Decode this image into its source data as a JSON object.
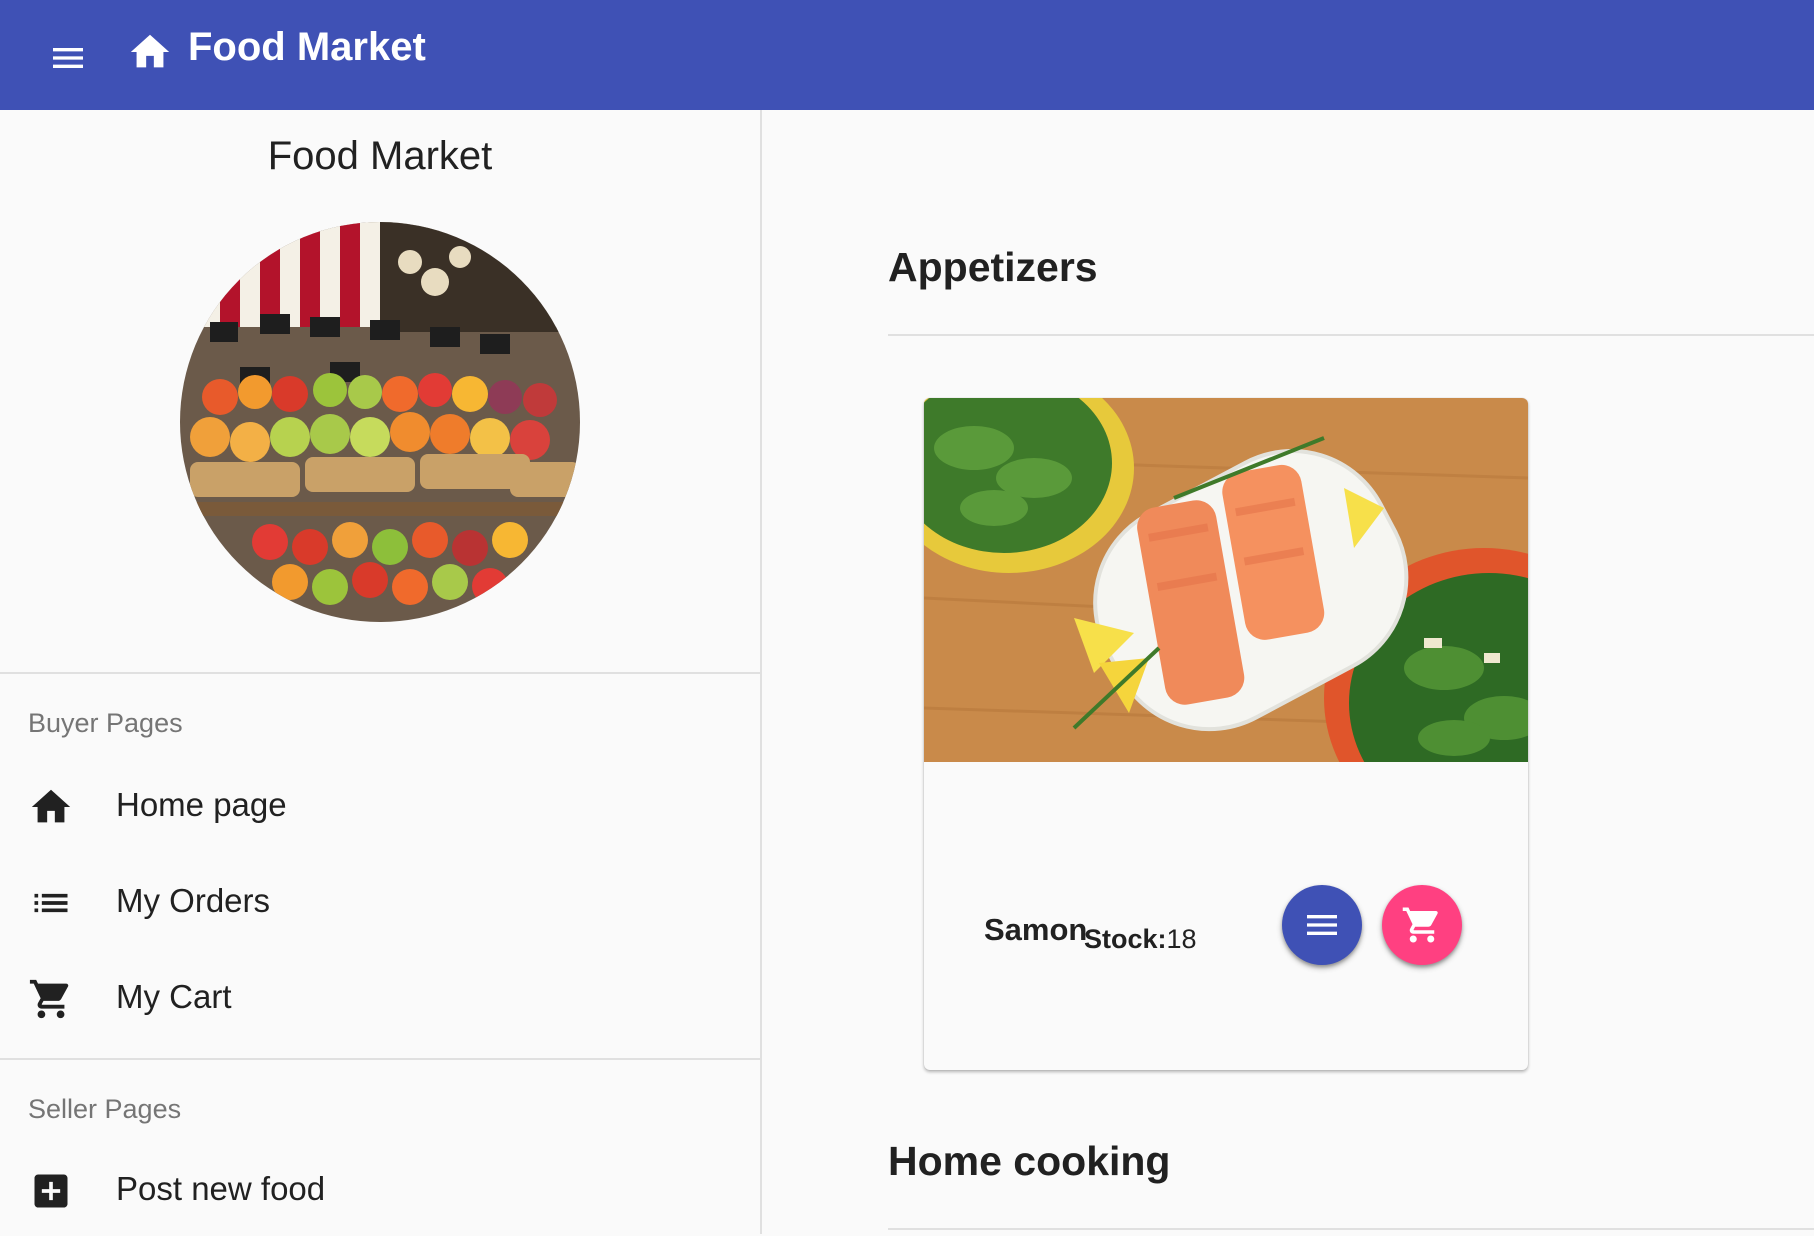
{
  "colors": {
    "primary": "#3f51b5",
    "accent": "#ff4081",
    "background": "#fafafa",
    "divider": "#e0e0e0",
    "subheader": "#757575"
  },
  "appbar": {
    "title": "Food Market",
    "menu_icon": "hamburger-menu-icon",
    "home_icon": "home-icon"
  },
  "drawer": {
    "title": "Food Market",
    "avatar": "fruit-market-stall-photo",
    "sections": [
      {
        "header": "Buyer Pages",
        "items": [
          {
            "label": "Home page",
            "icon": "home-icon"
          },
          {
            "label": "My Orders",
            "icon": "list-icon"
          },
          {
            "label": "My Cart",
            "icon": "shopping-cart-icon"
          }
        ]
      },
      {
        "header": "Seller Pages",
        "items": [
          {
            "label": "Post new food",
            "icon": "add-box-icon"
          }
        ]
      }
    ]
  },
  "main": {
    "categories": [
      {
        "title": "Appetizers",
        "items": [
          {
            "name": "Samon",
            "stock_label": "Stock:",
            "stock_value": "18",
            "image": "salmon-with-salads-photo",
            "actions": [
              "list-icon",
              "shopping-cart-icon"
            ]
          }
        ]
      },
      {
        "title": "Home cooking",
        "items": []
      }
    ]
  }
}
